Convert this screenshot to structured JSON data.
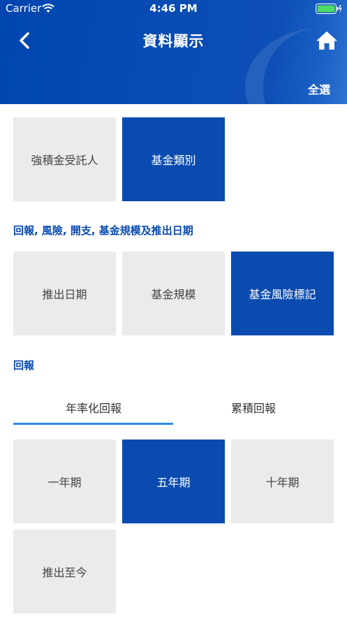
{
  "status_bar": {
    "carrier": "Carrier",
    "time": "4:46 PM"
  },
  "header": {
    "title": "資料顯示",
    "select_all": "全選"
  },
  "group1": {
    "tiles": [
      {
        "label": "強積金受託人",
        "selected": false
      },
      {
        "label": "基金類別",
        "selected": true
      }
    ]
  },
  "group2": {
    "heading": "回報, 風險, 開支, 基金規模及推出日期",
    "tiles": [
      {
        "label": "推出日期",
        "selected": false
      },
      {
        "label": "基金規模",
        "selected": false
      },
      {
        "label": "基金風險標記",
        "selected": true
      }
    ]
  },
  "returns": {
    "heading": "回報",
    "tabs": [
      {
        "label": "年率化回報",
        "active": true
      },
      {
        "label": "累積回報",
        "active": false
      }
    ],
    "tiles": [
      {
        "label": "一年期",
        "selected": false
      },
      {
        "label": "五年期",
        "selected": true
      },
      {
        "label": "十年期",
        "selected": false
      },
      {
        "label": "推出至今",
        "selected": false
      }
    ]
  },
  "colors": {
    "brand_blue": "#0a4bb0",
    "tab_underline": "#2a8ce8",
    "tile_gray": "#ebebeb"
  },
  "icons": {
    "back": "chevron-left-icon",
    "home": "home-icon",
    "wifi": "wifi-icon",
    "battery": "battery-icon"
  }
}
